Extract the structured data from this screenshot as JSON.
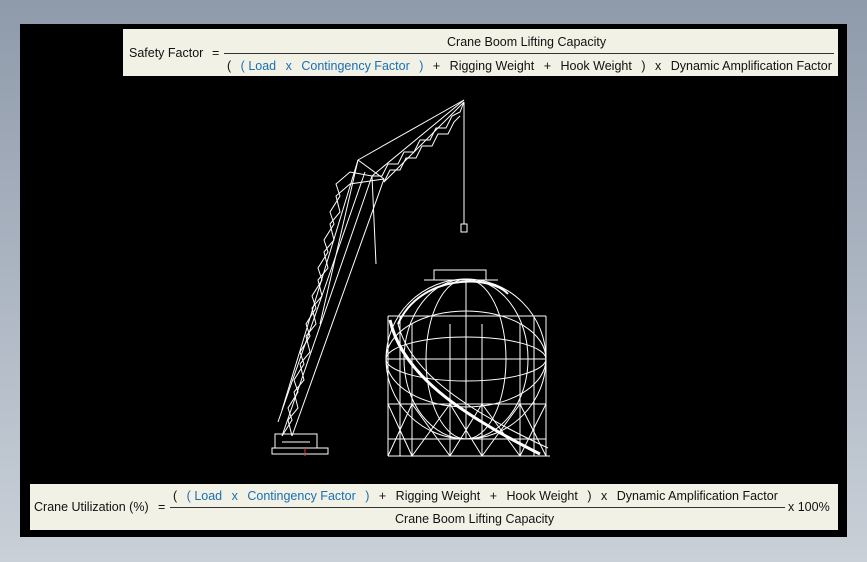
{
  "safety_factor": {
    "label": "Safety Factor",
    "equals": "=",
    "numerator": "Crane Boom Lifting Capacity",
    "denominator": {
      "open_outer": "(",
      "open_inner": "(",
      "load": "Load",
      "times1": "x",
      "contingency": "Contingency Factor",
      "close_inner": ")",
      "plus1": "+",
      "rigging": "Rigging Weight",
      "plus2": "+",
      "hook": "Hook Weight",
      "close_outer": ")",
      "times2": "x",
      "daf": "Dynamic Amplification Factor"
    }
  },
  "crane_utilization": {
    "label": "Crane Utilization (%)",
    "equals": "=",
    "numerator": {
      "open_outer": "(",
      "open_inner": "(",
      "load": "Load",
      "times1": "x",
      "contingency": "Contingency Factor",
      "close_inner": ")",
      "plus1": "+",
      "rigging": "Rigging Weight",
      "plus2": "+",
      "hook": "Hook Weight",
      "close_outer": ")",
      "times2": "x",
      "daf": "Dynamic Amplification Factor"
    },
    "denominator": "Crane Boom Lifting Capacity",
    "multiplier": "x 100%"
  },
  "colors": {
    "variable_highlight": "#1a6fb3",
    "background": "#000000",
    "linework": "#ffffff",
    "formula_panel": "#f2f1e6"
  }
}
